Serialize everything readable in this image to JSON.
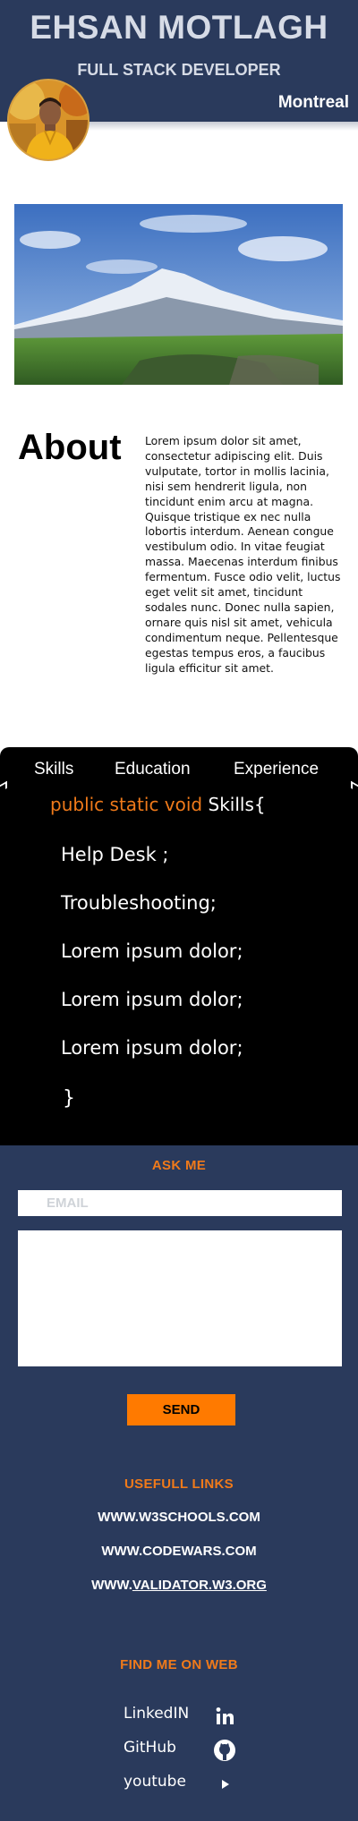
{
  "header": {
    "name": "EHSAN MOTLAGH",
    "role": "FULL STACK DEVELOPER",
    "city": "Montreal"
  },
  "about": {
    "title": "About",
    "text": "Lorem ipsum dolor sit amet, consectetur adipiscing elit. Duis vulputate, tortor in mollis lacinia, nisi sem hendrerit ligula, non tincidunt enim arcu at magna. Quisque tristique ex nec nulla  lobortis interdum. Aenean congue vestibulum odio. In vitae feugiat massa. Maecenas interdum finibus fermentum. Fusce odio velit, luctus eget velit sit amet, tincidunt sodales nunc. Donec nulla sapien, ornare quis nisl sit amet, vehicula condimentum neque. Pellentesque egestas tempus eros, a faucibus ligula efficitur sit amet."
  },
  "skills": {
    "tabs": [
      "Skills",
      "Education",
      "Experience"
    ],
    "code_keyword": "public static void",
    "code_name": "Skills{",
    "lines": [
      "Help Desk ;",
      "Troubleshooting;",
      "Lorem ipsum dolor;",
      "Lorem ipsum dolor;",
      "Lorem ipsum dolor;"
    ],
    "closing": "}"
  },
  "contact": {
    "title": "ASK ME",
    "email_placeholder": "EMAIL",
    "send_label": "SEND"
  },
  "links": {
    "title": "USEFULL LINKS",
    "items": [
      "WWW.W3SCHOOLS.COM",
      "WWW.CODEWARS.COM"
    ],
    "validator_prefix": "WWW.",
    "validator_underlined": "VALIDATOR.W3.ORG"
  },
  "social": {
    "title": "FIND ME ON WEB",
    "items": [
      {
        "label": "LinkedIN",
        "icon": "linkedin-icon"
      },
      {
        "label": "GitHub",
        "icon": "github-icon"
      },
      {
        "label": "youtube",
        "icon": "youtube-icon"
      }
    ]
  },
  "colors": {
    "navy": "#2a3a5c",
    "accent": "#f07a1a",
    "button": "#ff7a00"
  }
}
